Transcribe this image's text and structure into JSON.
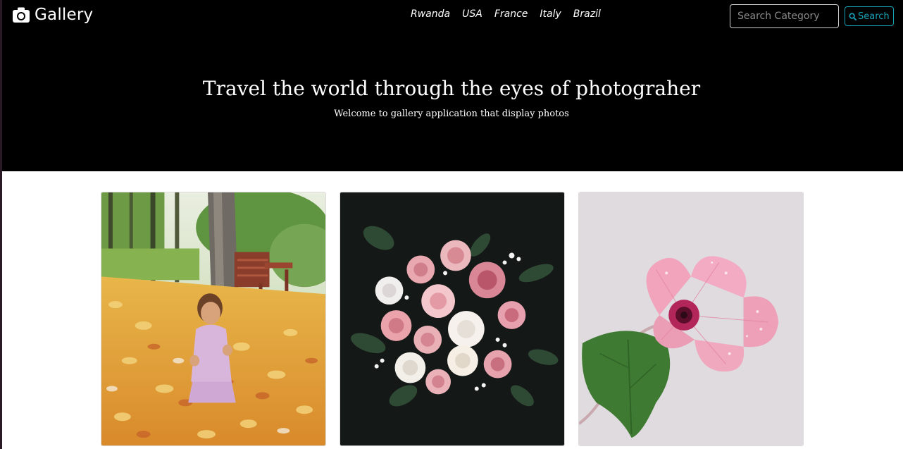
{
  "navbar": {
    "brand": "Gallery",
    "brand_icon": "camera-icon",
    "links": [
      "Rwanda",
      "USA",
      "France",
      "Italy",
      "Brazil"
    ],
    "search": {
      "placeholder": "Search Category",
      "value": "",
      "button_label": "Search",
      "button_icon": "search-icon",
      "accent_color": "#17a2b8"
    }
  },
  "hero": {
    "title": "Travel the world through the eyes of photograher",
    "subtitle": "Welcome to gallery application that display photos",
    "background": "#000000"
  },
  "gallery": {
    "photos": [
      {
        "subject": "child sitting in autumn leaves beside a bench"
      },
      {
        "subject": "bouquet of pink and white roses on dark background"
      },
      {
        "subject": "pink hibiscus flower with green leaf"
      }
    ]
  }
}
